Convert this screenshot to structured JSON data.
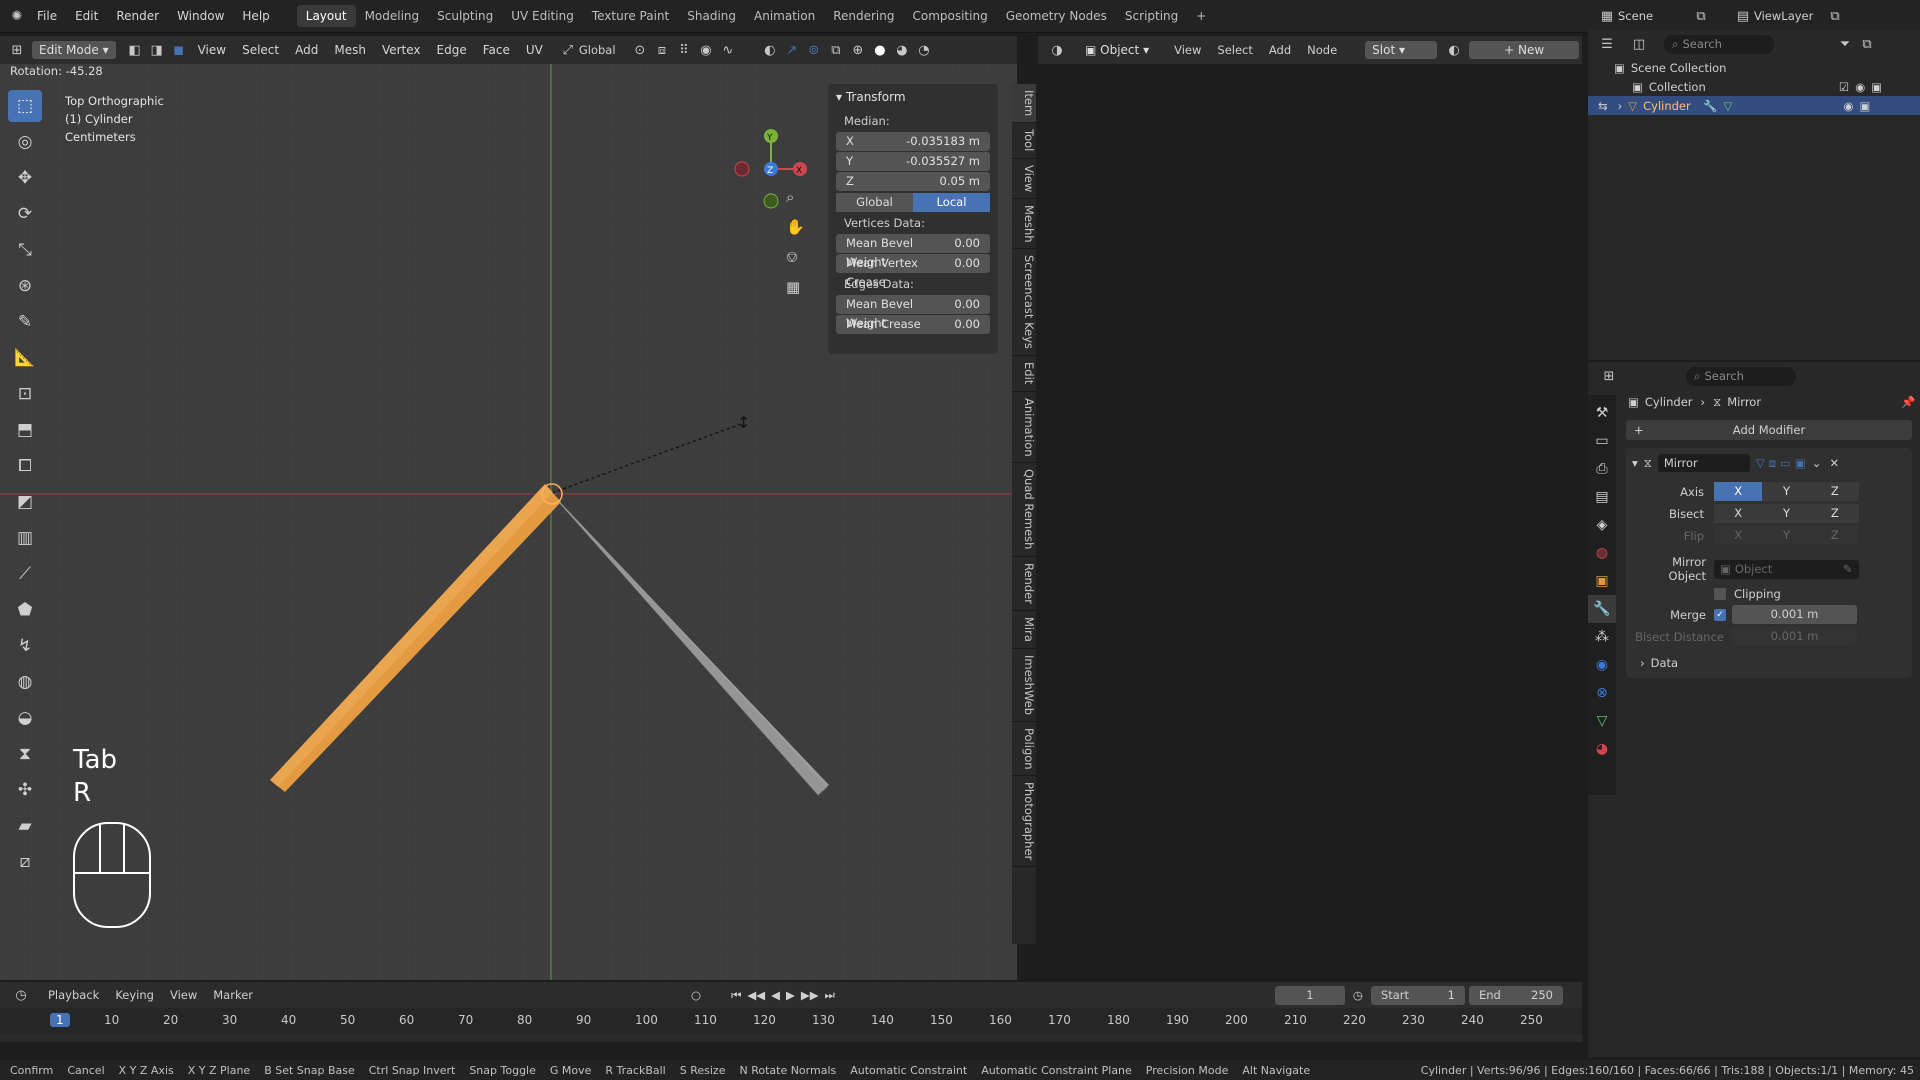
{
  "app": {
    "menu": [
      "File",
      "Edit",
      "Render",
      "Window",
      "Help"
    ],
    "workspaces": [
      "Layout",
      "Modeling",
      "Sculpting",
      "UV Editing",
      "Texture Paint",
      "Shading",
      "Animation",
      "Rendering",
      "Compositing",
      "Geometry Nodes",
      "Scripting"
    ],
    "active_workspace": "Layout",
    "scene": "Scene",
    "view_layer": "ViewLayer"
  },
  "viewport": {
    "mode": "Edit Mode",
    "menus": [
      "View",
      "Select",
      "Add",
      "Mesh",
      "Vertex",
      "Edge",
      "Face",
      "UV"
    ],
    "orientation": "Global",
    "rotation": "Rotation: -45.28",
    "view_name": "Top Orthographic",
    "object_name": "(1) Cylinder",
    "units": "Centimeters",
    "key1": "Tab",
    "key2": "R",
    "gizmo": {
      "x": "X",
      "y": "Y",
      "z": "Z"
    }
  },
  "npanel": {
    "title": "Transform",
    "median": "Median:",
    "x_label": "X",
    "x": "-0.035183 m",
    "y_label": "Y",
    "y": "-0.035527 m",
    "z_label": "Z",
    "z": "0.05 m",
    "global": "Global",
    "local": "Local",
    "vertices_data": "Vertices Data:",
    "mean_bevel_weight": "Mean Bevel Weight",
    "mbw_v": "0.00",
    "mean_vertex_crease": "Mean Vertex Crease",
    "mvc_v": "0.00",
    "edges_data": "Edges Data:",
    "mean_bevel_weight_e": "Mean Bevel Weight",
    "mbwe_v": "0.00",
    "mean_crease": "Mean Crease",
    "mc_v": "0.00",
    "tabs": [
      "Item",
      "Tool",
      "View",
      "Meshh",
      "Screencast Keys",
      "Edit",
      "Animation",
      "Quad Remesh",
      "Render",
      "Mira",
      "ImeshWeb",
      "Poligon",
      "Photographer"
    ]
  },
  "node_editor": {
    "type": "Object",
    "menus": [
      "View",
      "Select",
      "Add",
      "Node"
    ],
    "slot": "Slot",
    "new": "New"
  },
  "outliner": {
    "search": "Search",
    "scene_collection": "Scene Collection",
    "collection": "Collection",
    "object": "Cylinder"
  },
  "properties": {
    "search": "Search",
    "breadcrumb_obj": "Cylinder",
    "breadcrumb_mod": "Mirror",
    "add_modifier": "Add Modifier",
    "modifier_name": "Mirror",
    "axis": "Axis",
    "bisect": "Bisect",
    "flip": "Flip",
    "x": "X",
    "y": "Y",
    "z": "Z",
    "mirror_object": "Mirror Object",
    "object_placeholder": "Object",
    "clipping": "Clipping",
    "merge": "Merge",
    "merge_value": "0.001 m",
    "bisect_distance": "Bisect Distance",
    "bisect_value": "0.001 m",
    "data": "Data"
  },
  "timeline": {
    "menus": [
      "Playback",
      "Keying",
      "View",
      "Marker"
    ],
    "current_frame": "1",
    "start_label": "Start",
    "start": "1",
    "end_label": "End",
    "end": "250",
    "ticks": [
      "1",
      "10",
      "20",
      "30",
      "40",
      "50",
      "60",
      "70",
      "80",
      "90",
      "100",
      "110",
      "120",
      "130",
      "140",
      "150",
      "160",
      "170",
      "180",
      "190",
      "200",
      "210",
      "220",
      "230",
      "240",
      "250"
    ]
  },
  "statusbar": {
    "items": [
      "Confirm",
      "Cancel",
      "X Y Z Axis",
      "X Y Z Plane",
      "B Set Snap Base",
      "Ctrl Snap Invert",
      "Snap Toggle",
      "G Move",
      "R TrackBall",
      "S Resize",
      "N Rotate Normals",
      "Automatic Constraint",
      "Automatic Constraint Plane",
      "Precision Mode",
      "Alt Navigate"
    ],
    "stats": "Cylinder | Verts:96/96 | Edges:160/160 | Faces:66/66 | Tris:188 | Objects:1/1 | Memory: 45"
  },
  "colors": {
    "accent": "#4772b3",
    "selected_mesh": "#e09a3e",
    "mesh": "#9a9a9a",
    "x_axis": "#d0464f",
    "y_axis": "#7ab33a",
    "z_axis": "#3c7ad9"
  }
}
